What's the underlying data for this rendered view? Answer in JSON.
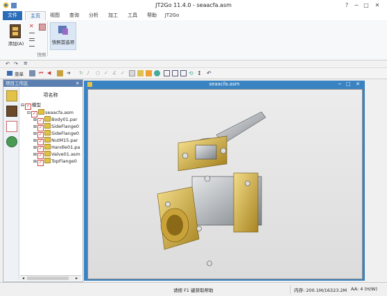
{
  "window": {
    "title": "JT2Go 11.4.0 - seaacfa.asm",
    "help": "?",
    "minimize": "−",
    "maximize": "□",
    "close": "✕"
  },
  "tabs": [
    "文件",
    "主页",
    "视图",
    "查询",
    "分析",
    "加工",
    "工具",
    "帮助",
    "JT2Go"
  ],
  "ribbon": {
    "add_label": "添加(A)",
    "quick_select_label": "快照首选项",
    "group_label": "快照"
  },
  "toolbar": {
    "menu_label": "菜单"
  },
  "left_panel": {
    "title": "项目工作区",
    "close": "✕",
    "column_header": "项名称",
    "tree": [
      {
        "text": "模型",
        "indent": 0,
        "kind": "root"
      },
      {
        "text": "seaacfa.asm",
        "indent": 1,
        "kind": "asm"
      },
      {
        "text": "Body01.par",
        "indent": 2,
        "kind": "part"
      },
      {
        "text": "SideFlange0",
        "indent": 2,
        "kind": "part"
      },
      {
        "text": "SideFlange0",
        "indent": 2,
        "kind": "part"
      },
      {
        "text": "NutM15.par",
        "indent": 2,
        "kind": "part"
      },
      {
        "text": "Handle01.pa",
        "indent": 2,
        "kind": "part"
      },
      {
        "text": "Valve01.asm",
        "indent": 2,
        "kind": "part"
      },
      {
        "text": "TopFlange0",
        "indent": 2,
        "kind": "part"
      }
    ]
  },
  "viewer": {
    "title": "seaacfa.asm"
  },
  "status": {
    "help_text": "请按 F1 键获取帮助",
    "memory": "内存: 200.1M/16323.2M",
    "aa": "AA: 4 (H/W)"
  },
  "colors": {
    "accent": "#2b6cb8",
    "viewer_frame": "#3a83c2",
    "brass": "#d4b24a",
    "steel": "#b8bcc2"
  }
}
